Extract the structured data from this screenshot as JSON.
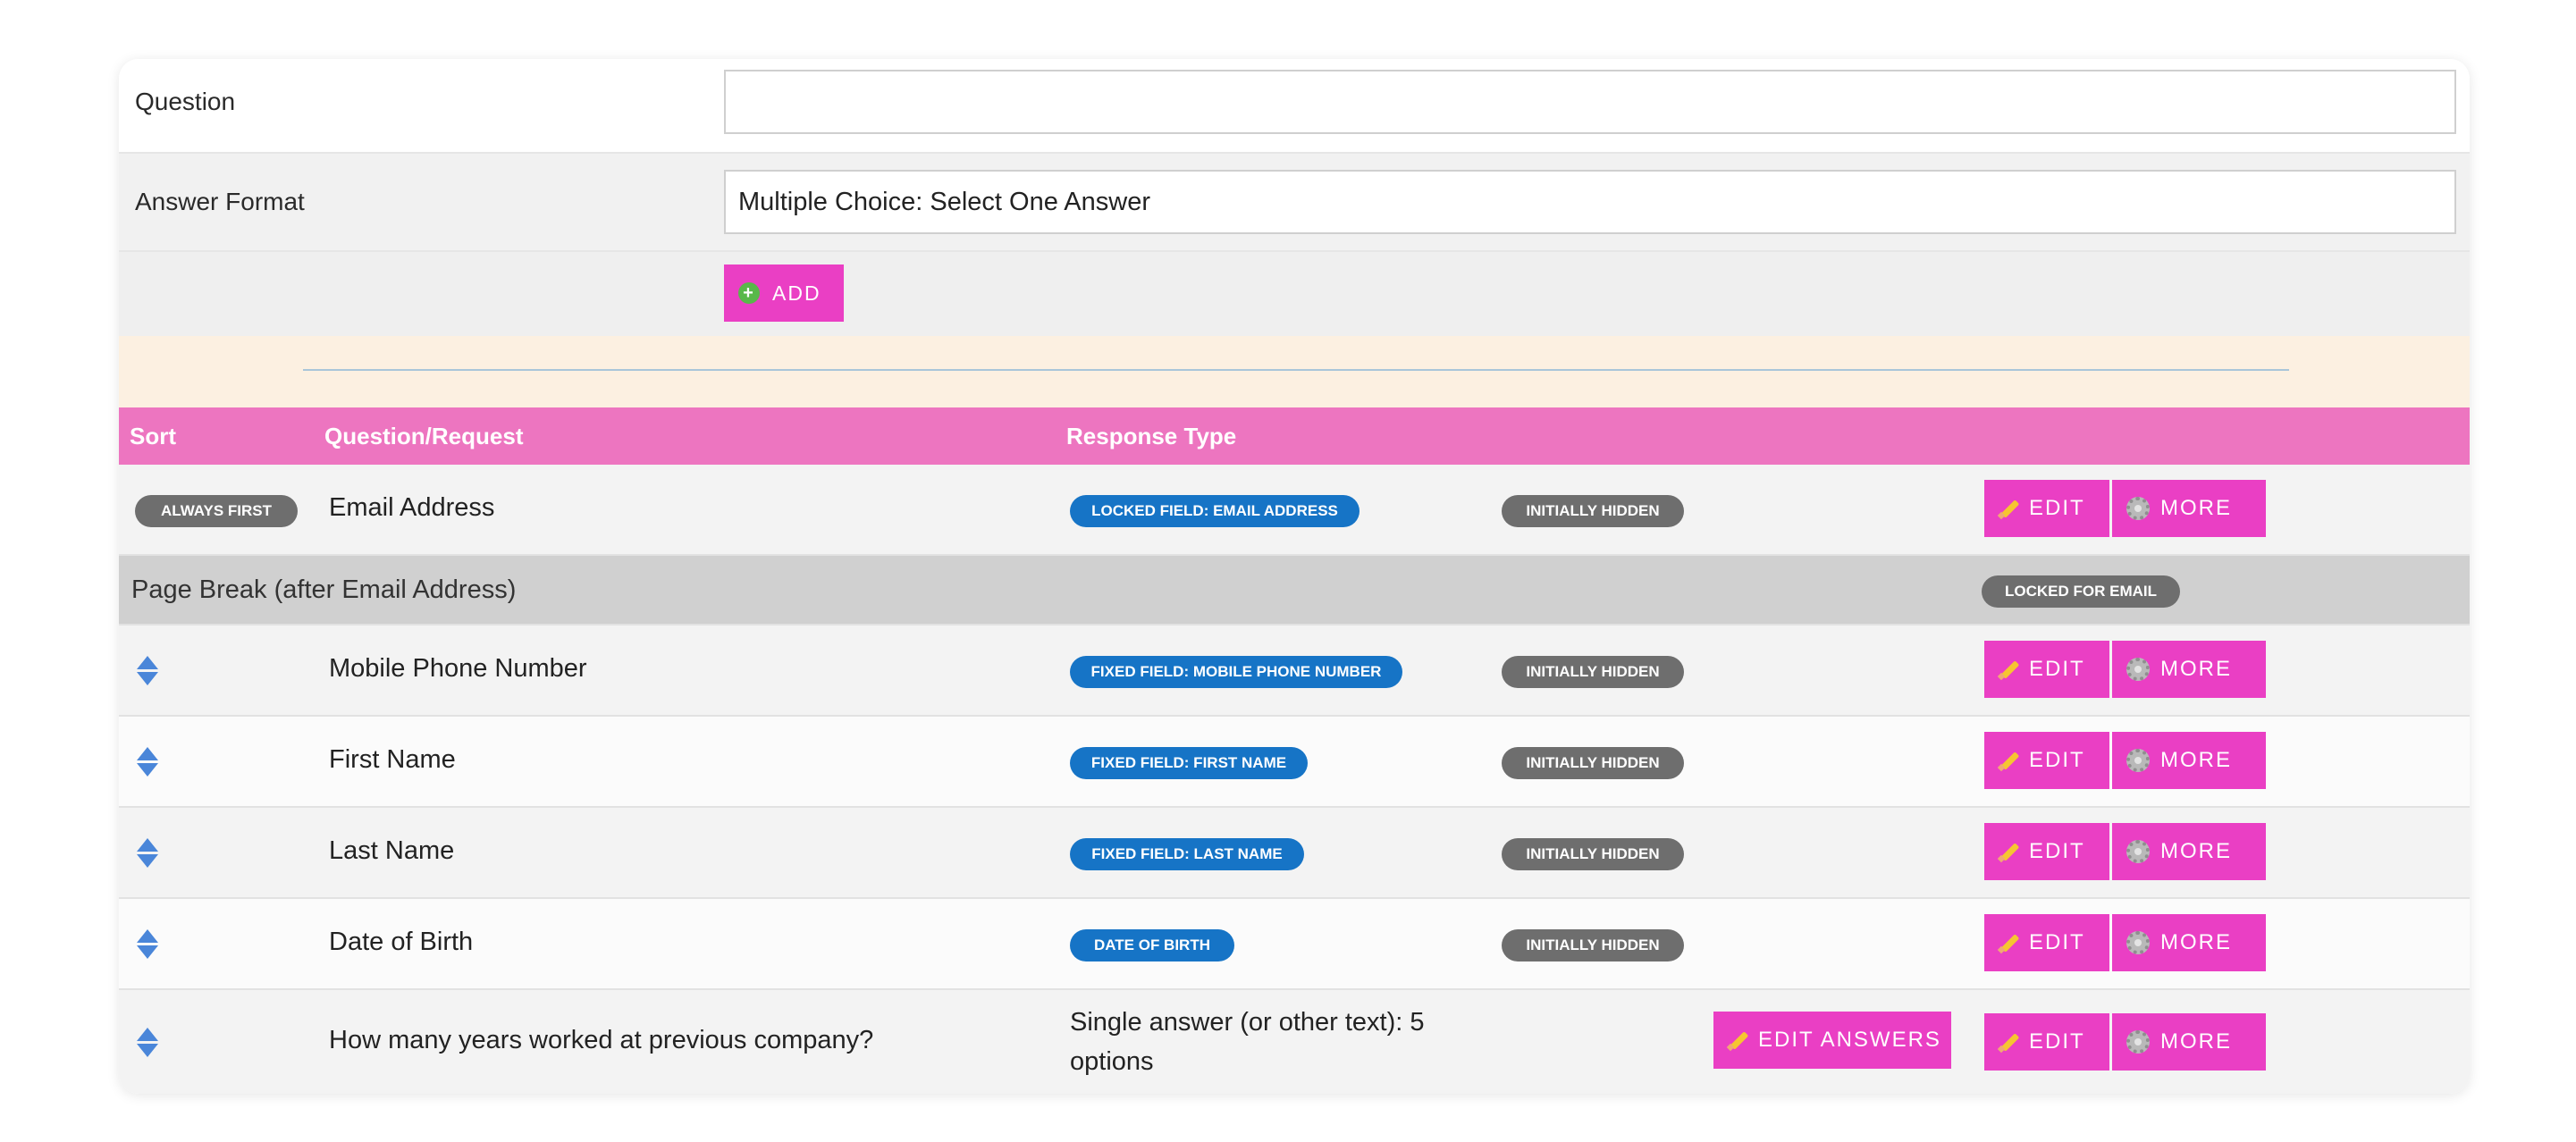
{
  "form": {
    "question_label": "Question",
    "question_value": "",
    "answer_format_label": "Answer Format",
    "answer_format_value": "Multiple Choice: Select One Answer",
    "add_label": "ADD"
  },
  "table": {
    "headers": {
      "sort": "Sort",
      "question": "Question/Request",
      "response": "Response Type"
    },
    "rows": [
      {
        "sort_badge": "ALWAYS FIRST",
        "question": "Email Address",
        "response_badge": "LOCKED FIELD: EMAIL ADDRESS",
        "status_badge": "INITIALLY HIDDEN",
        "edit": "EDIT",
        "more": "MORE"
      },
      {
        "page_break": "Page Break (after Email Address)",
        "lock_badge": "LOCKED FOR EMAIL"
      },
      {
        "question": "Mobile Phone Number",
        "response_badge": "FIXED FIELD: MOBILE PHONE NUMBER",
        "status_badge": "INITIALLY HIDDEN",
        "edit": "EDIT",
        "more": "MORE"
      },
      {
        "question": "First Name",
        "response_badge": "FIXED FIELD: FIRST NAME",
        "status_badge": "INITIALLY HIDDEN",
        "edit": "EDIT",
        "more": "MORE"
      },
      {
        "question": "Last Name",
        "response_badge": "FIXED FIELD: LAST NAME",
        "status_badge": "INITIALLY HIDDEN",
        "edit": "EDIT",
        "more": "MORE"
      },
      {
        "question": "Date of Birth",
        "response_badge": "DATE OF BIRTH",
        "status_badge": "INITIALLY HIDDEN",
        "edit": "EDIT",
        "more": "MORE"
      },
      {
        "question": "How many years worked at previous company?",
        "response_text": "Single answer (or other text): 5 options",
        "edit_answers": "EDIT ANSWERS",
        "edit": "EDIT",
        "more": "MORE"
      }
    ]
  },
  "icons": {
    "add": "plus-circle-icon",
    "edit": "pencil-icon",
    "more": "gear-icon",
    "sort": "sort-arrows-icon"
  },
  "colors": {
    "accent": "#ea3fc4",
    "header": "#ed75c0",
    "blue_badge": "#1674c6",
    "gray_badge": "#6e6e6e",
    "divider_bg": "#fcf0e1"
  }
}
